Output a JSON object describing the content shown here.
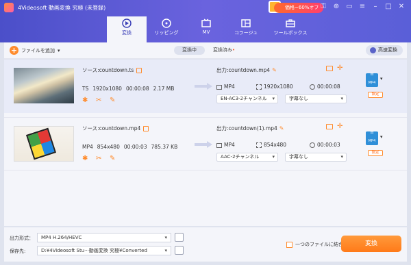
{
  "app": {
    "title": "4Videosoft 動画変換 究極 (未登録)"
  },
  "promo": {
    "label": "価格~60%オフ"
  },
  "tabs": [
    {
      "label": "変換",
      "icon": "convert-icon"
    },
    {
      "label": "リッピング",
      "icon": "disc-icon"
    },
    {
      "label": "MV",
      "icon": "mv-icon"
    },
    {
      "label": "コラージュ",
      "icon": "collage-icon"
    },
    {
      "label": "ツールボックス",
      "icon": "toolbox-icon"
    }
  ],
  "toolbar": {
    "add_files": "ファイルを追加",
    "converting": "変換中",
    "converted": "変換済み",
    "converted_dot": "•",
    "speed": "高速変換"
  },
  "files": [
    {
      "source": "ソース:countdown.ts",
      "format": "TS",
      "resolution": "1920x1080",
      "duration": "00:00:08",
      "size": "2.17 MB",
      "output": "出力:countdown.mp4",
      "out_format": "MP4",
      "out_resolution": "1920x1080",
      "out_duration": "00:00:08",
      "audio": "EN-AC3-2チャンネル",
      "subtitle": "字幕なし",
      "format_badge": "MP4",
      "settings": "設定"
    },
    {
      "source": "ソース:countdown.mp4",
      "format": "MP4",
      "resolution": "854x480",
      "duration": "00:00:03",
      "size": "785.37 KB",
      "output": "出力:countdown(1).mp4",
      "out_format": "MP4",
      "out_resolution": "854x480",
      "out_duration": "00:00:03",
      "audio": "AAC-2チャンネル",
      "subtitle": "字幕なし",
      "format_badge": "MP4",
      "settings": "設定"
    }
  ],
  "bottom": {
    "output_format_label": "出力形式：",
    "output_format_value": "MP4 H.264/HEVC",
    "save_to_label": "保存先:",
    "save_to_value": "D:¥4Videosoft Stu···動画変換 究極¥Converted",
    "merge_label": "一つのファイルに結合",
    "convert_button": "変換"
  },
  "colors": {
    "accent": "#ff8b2c",
    "header": "#5457d0"
  }
}
